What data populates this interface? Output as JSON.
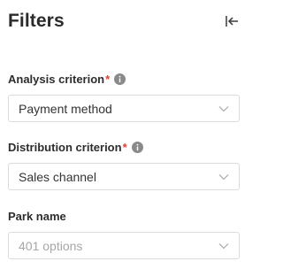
{
  "header": {
    "title": "Filters",
    "collapse_icon": "collapse-left-icon"
  },
  "fields": [
    {
      "label": "Analysis criterion",
      "required_marker": "*",
      "value": "Payment method",
      "info_icon": "info-icon"
    },
    {
      "label": "Distribution criterion",
      "required_marker": "*",
      "value": "Sales channel",
      "info_icon": "info-icon"
    },
    {
      "label": "Park name",
      "placeholder": "401 options"
    }
  ],
  "colors": {
    "required": "#e0403a",
    "border": "#dcdcdc",
    "placeholder": "#a6a6a6"
  }
}
